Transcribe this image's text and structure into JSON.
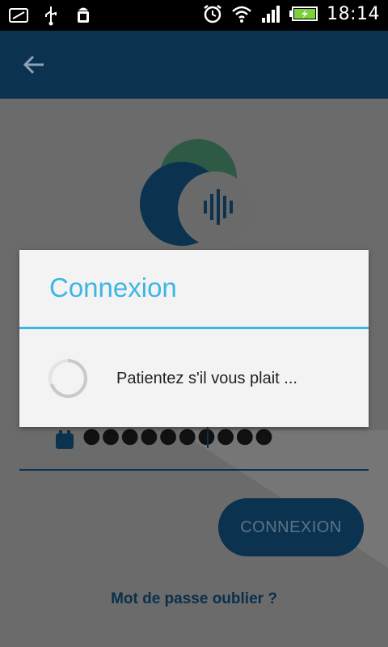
{
  "status_bar": {
    "time": "18:14",
    "icons": [
      "screen-icon",
      "usb-icon",
      "android-debug-icon",
      "alarm-icon",
      "wifi-icon",
      "signal-icon",
      "battery-charging-icon"
    ]
  },
  "app_bar": {
    "back_icon": "arrow-left-icon"
  },
  "login_form": {
    "password_value": "●●●●●●●●●●",
    "login_button": "CONNEXION",
    "forgot_link": "Mot de passe oublier ?"
  },
  "dialog": {
    "title": "Connexion",
    "message": "Patientez s'il vous plait ..."
  },
  "colors": {
    "accent": "#3db6e6",
    "primary_dark": "#0b3350",
    "overlay_gray": "#6b6b6b"
  }
}
